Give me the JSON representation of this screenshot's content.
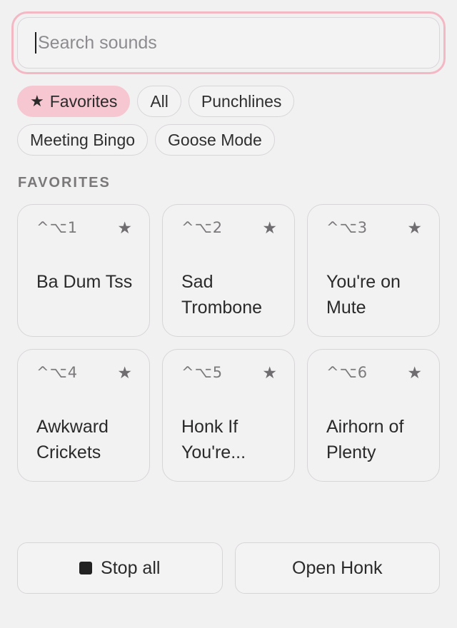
{
  "search": {
    "placeholder": "Search sounds"
  },
  "chips": [
    {
      "label": "Favorites",
      "icon": "star-icon",
      "active": true
    },
    {
      "label": "All"
    },
    {
      "label": "Punchlines"
    },
    {
      "label": "Meeting Bingo"
    },
    {
      "label": "Goose Mode"
    }
  ],
  "section": {
    "title": "FAVORITES"
  },
  "sounds": [
    {
      "shortcut": "^⌥1",
      "name": "Ba Dum Tss"
    },
    {
      "shortcut": "^⌥2",
      "name": "Sad Trombone"
    },
    {
      "shortcut": "^⌥3",
      "name": "You're on Mute"
    },
    {
      "shortcut": "^⌥4",
      "name": "Awkward Crickets"
    },
    {
      "shortcut": "^⌥5",
      "name": "Honk If You're..."
    },
    {
      "shortcut": "^⌥6",
      "name": "Airhorn of Plenty"
    }
  ],
  "star_glyph": "★",
  "footer": {
    "stop_label": "Stop all",
    "open_label": "Open Honk"
  },
  "colors": {
    "accent": "#f6c7d1",
    "focus_ring": "#f4b8c4"
  }
}
